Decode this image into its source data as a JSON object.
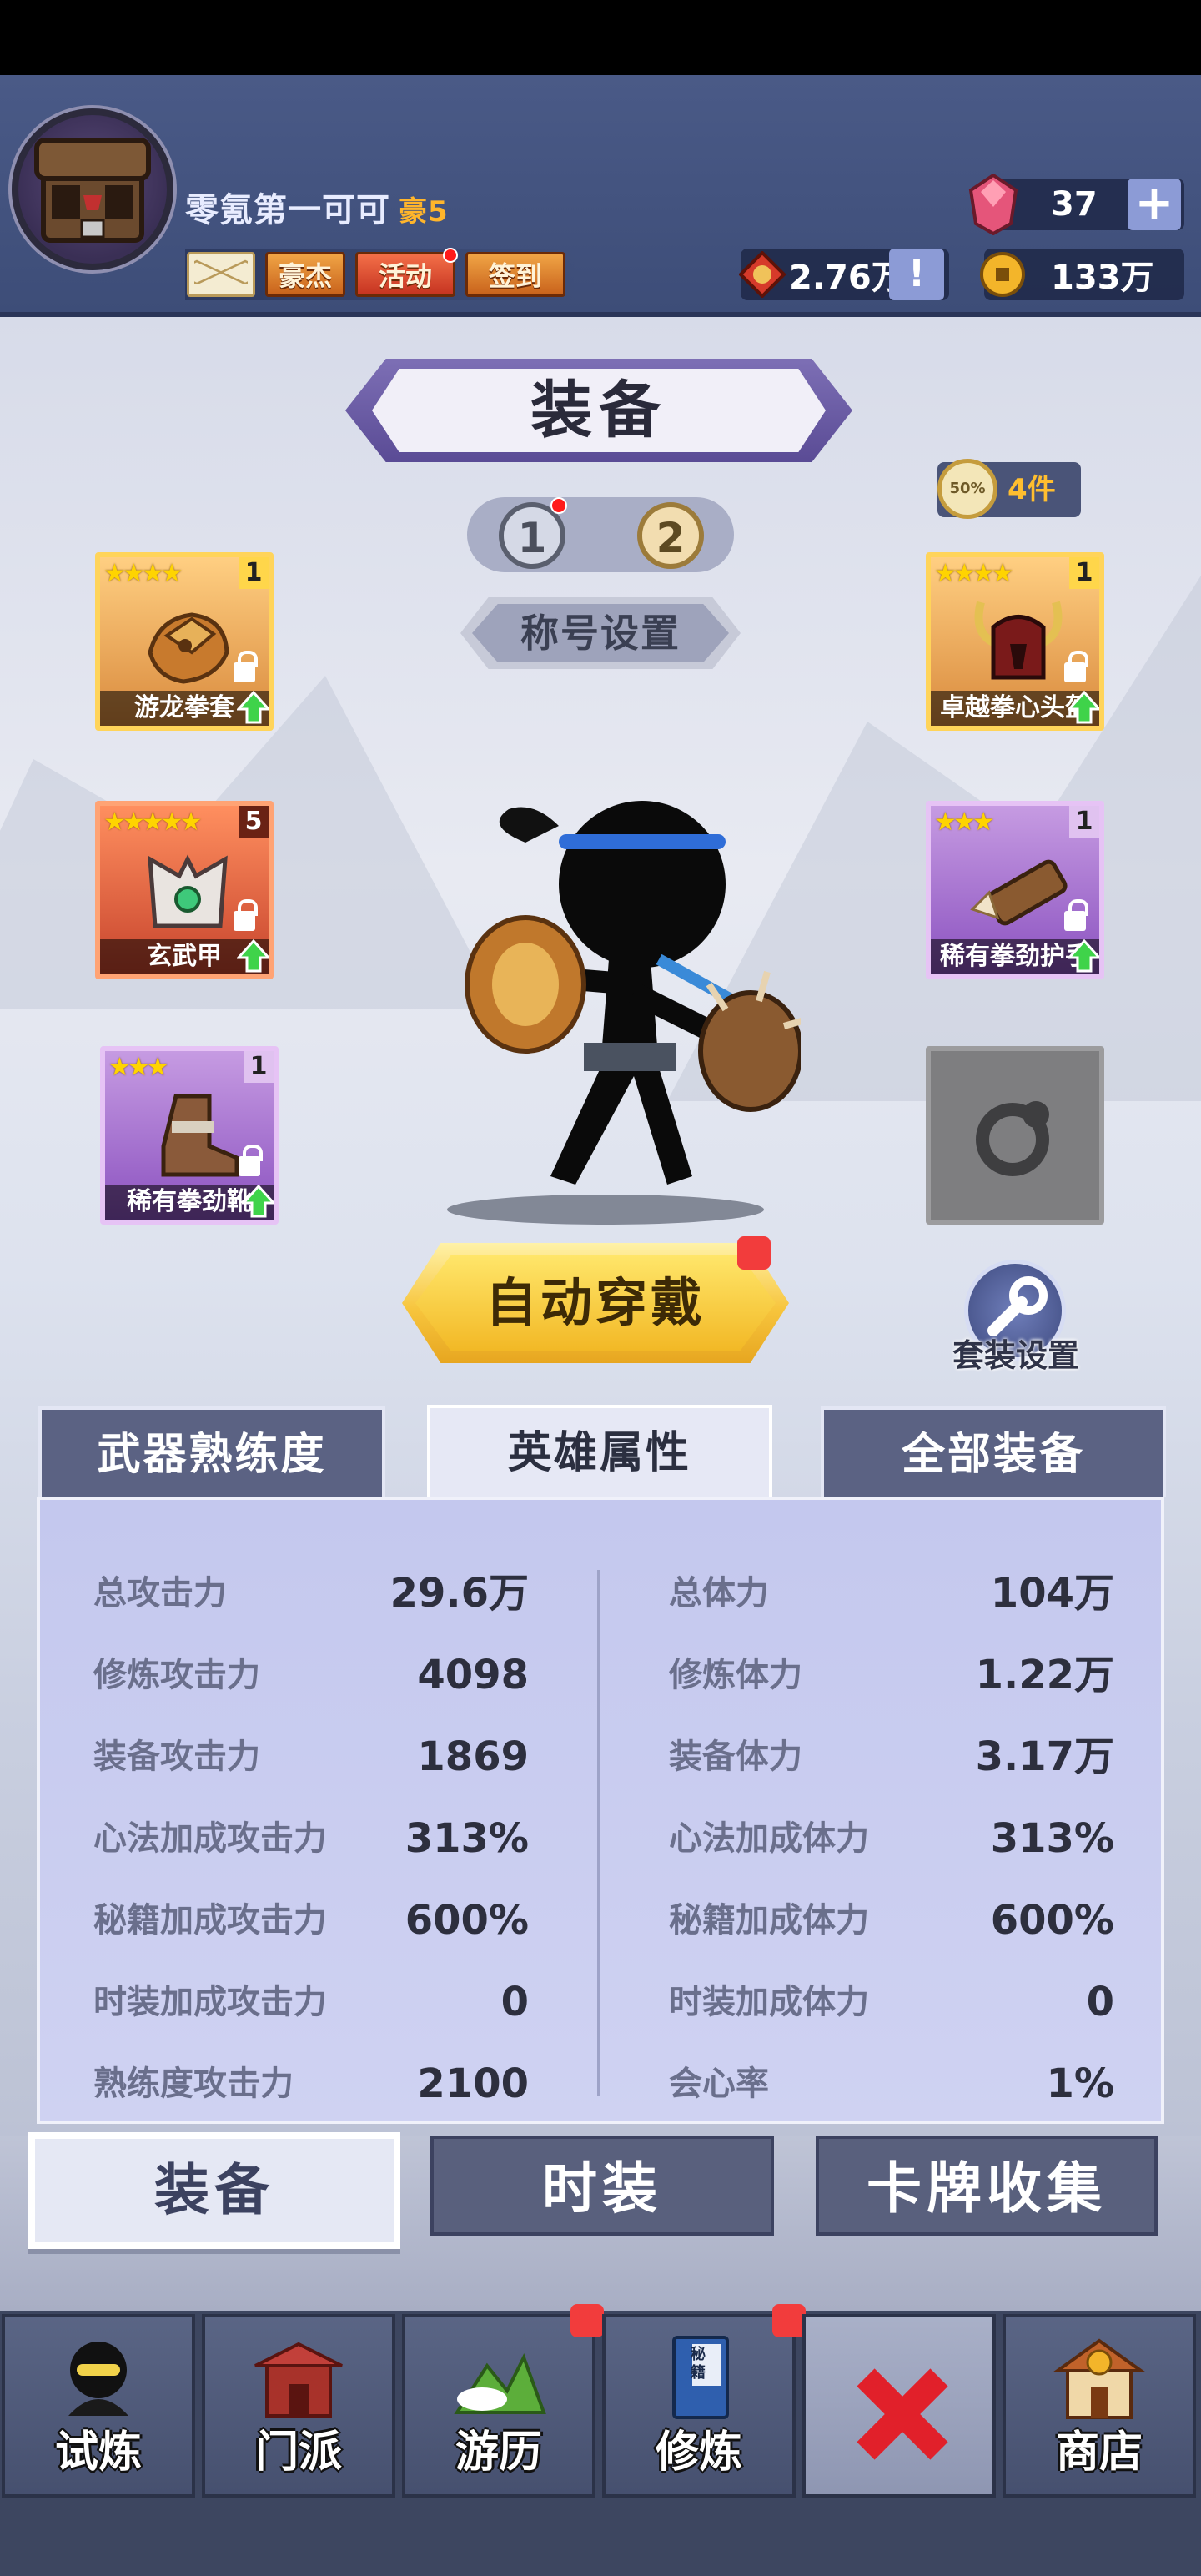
{
  "player": {
    "name": "零氪第一可可",
    "vip": "豪5"
  },
  "header_menu": {
    "hero_label": "豪杰",
    "event_label": "活动",
    "checkin_label": "签到"
  },
  "currency": {
    "gems": "37",
    "honor": "2.76万",
    "coins": "133万"
  },
  "page": {
    "title": "装备",
    "preset_1": "1",
    "preset_2": "2",
    "title_setting": "称号设置",
    "set_count": "4件",
    "set_icon_text": "50%"
  },
  "slots": {
    "left_top": {
      "name": "游龙拳套",
      "stars": "★★★★",
      "level": "1"
    },
    "left_mid": {
      "name": "玄武甲",
      "stars": "★★★★★",
      "level": "5"
    },
    "left_bot": {
      "name": "稀有拳劲靴",
      "stars": "★★★",
      "level": "1"
    },
    "right_top": {
      "name": "卓越拳心头盔",
      "stars": "★★★★",
      "level": "1"
    },
    "right_mid": {
      "name": "稀有拳劲护手",
      "stars": "★★★",
      "level": "1"
    }
  },
  "actions": {
    "auto_equip": "自动穿戴",
    "suit_setting": "套装设置"
  },
  "tabs": {
    "mastery": "武器熟练度",
    "attributes": "英雄属性",
    "all_equip": "全部装备"
  },
  "stats": {
    "left": [
      {
        "label": "总攻击力",
        "value": "29.6万"
      },
      {
        "label": "修炼攻击力",
        "value": "4098"
      },
      {
        "label": "装备攻击力",
        "value": "1869"
      },
      {
        "label": "心法加成攻击力",
        "value": "313%"
      },
      {
        "label": "秘籍加成攻击力",
        "value": "600%"
      },
      {
        "label": "时装加成攻击力",
        "value": "0"
      },
      {
        "label": "熟练度攻击力",
        "value": "2100"
      }
    ],
    "right": [
      {
        "label": "总体力",
        "value": "104万"
      },
      {
        "label": "修炼体力",
        "value": "1.22万"
      },
      {
        "label": "装备体力",
        "value": "3.17万"
      },
      {
        "label": "心法加成体力",
        "value": "313%"
      },
      {
        "label": "秘籍加成体力",
        "value": "600%"
      },
      {
        "label": "时装加成体力",
        "value": "0"
      },
      {
        "label": "会心率",
        "value": "1%"
      }
    ]
  },
  "subtabs": {
    "equip": "装备",
    "fashion": "时装",
    "card": "卡牌收集"
  },
  "nav": {
    "trial": "试炼",
    "sect": "门派",
    "travel": "游历",
    "cultivate": "修炼",
    "shop": "商店",
    "book_text": "秘籍"
  }
}
